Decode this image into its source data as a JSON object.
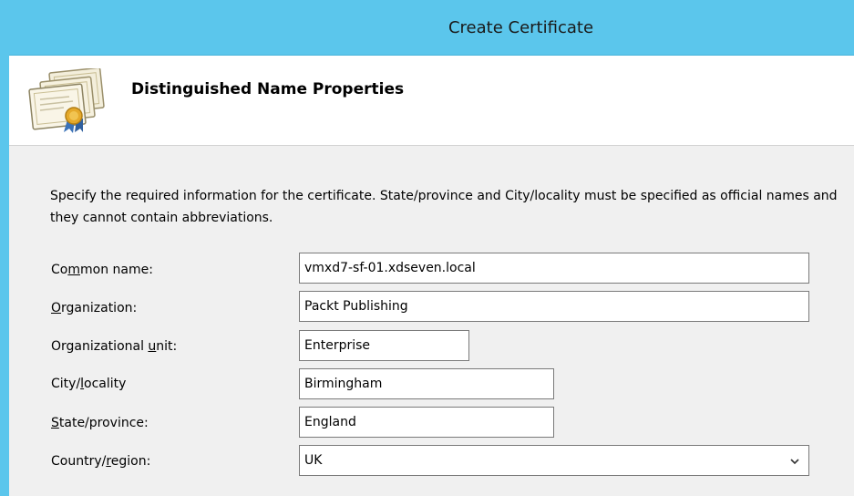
{
  "window": {
    "title": "Create Certificate"
  },
  "header": {
    "heading": "Distinguished Name Properties",
    "icon": "certificate-icon"
  },
  "instructions": "Specify the required information for the certificate. State/province and City/locality must be specified as official names and they cannot contain abbreviations.",
  "fields": [
    {
      "label_pre": "Co",
      "label_key": "m",
      "label_post": "mon name:",
      "value": "vmxd7-sf-01.xdseven.local"
    },
    {
      "label_pre": "",
      "label_key": "O",
      "label_post": "rganization:",
      "value": "Packt Publishing"
    },
    {
      "label_pre": "Organizational ",
      "label_key": "u",
      "label_post": "nit:",
      "value": "Enterprise"
    },
    {
      "label_pre": "City/",
      "label_key": "l",
      "label_post": "ocality",
      "value": "Birmingham"
    },
    {
      "label_pre": "",
      "label_key": "S",
      "label_post": "tate/province:",
      "value": "England"
    },
    {
      "label_pre": "Country/",
      "label_key": "r",
      "label_post": "egion:",
      "value": "UK"
    }
  ],
  "colors": {
    "titlebar": "#5bc6ec",
    "content_bg": "#f0f0f0",
    "field_border": "#7a7a7a"
  }
}
